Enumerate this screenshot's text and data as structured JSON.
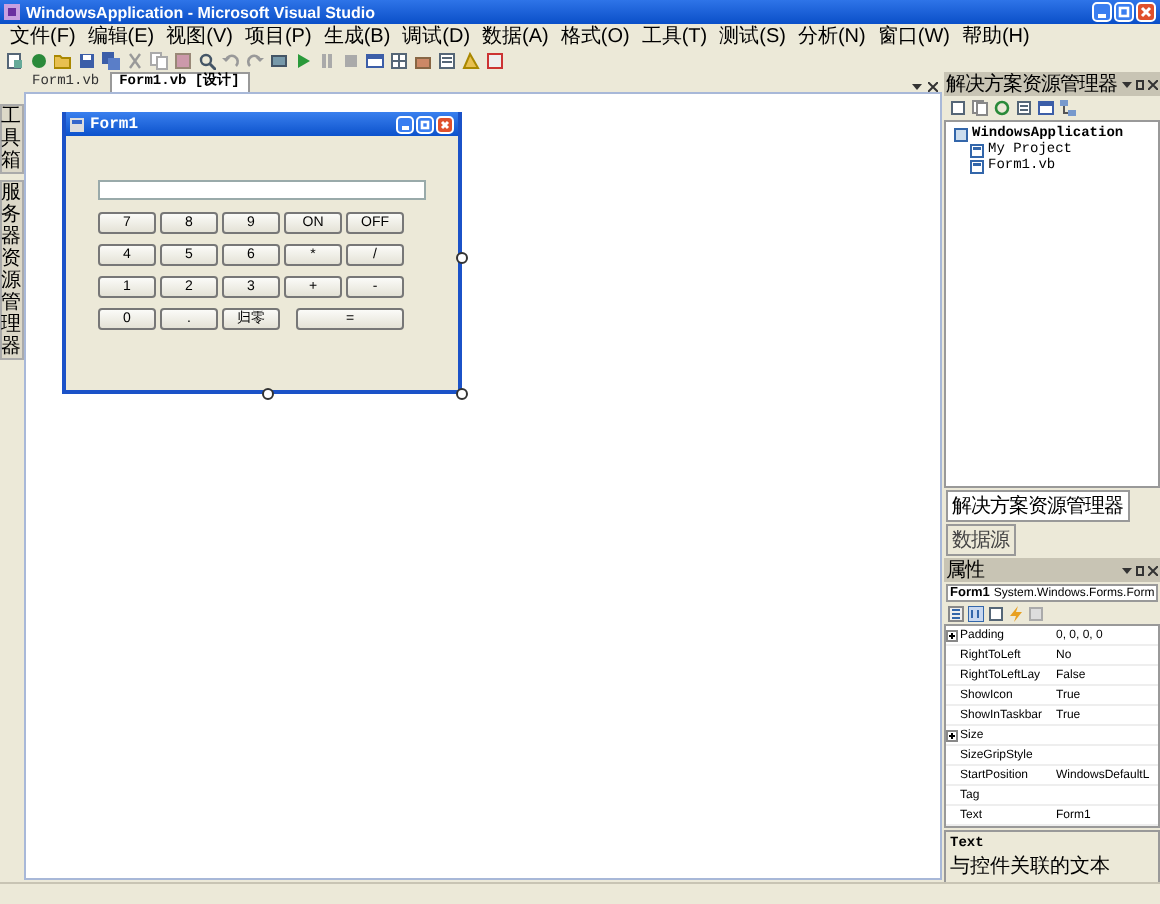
{
  "window": {
    "title": "WindowsApplication - Microsoft Visual Studio"
  },
  "menu": [
    "文件(F)",
    "编辑(E)",
    "视图(V)",
    "项目(P)",
    "生成(B)",
    "调试(D)",
    "数据(A)",
    "格式(O)",
    "工具(T)",
    "测试(S)",
    "分析(N)",
    "窗口(W)",
    "帮助(H)"
  ],
  "document_tabs": [
    {
      "label": "Form1.vb",
      "selected": false
    },
    {
      "label": "Form1.vb [设计]",
      "selected": true
    }
  ],
  "side_tabs": [
    "工具箱",
    "服务器资源管理器"
  ],
  "form": {
    "title": "Form1",
    "buttons": [
      {
        "label": "7",
        "kind": "normal"
      },
      {
        "label": "8",
        "kind": "normal"
      },
      {
        "label": "9",
        "kind": "normal"
      },
      {
        "label": "ON",
        "kind": "normal"
      },
      {
        "label": "OFF",
        "kind": "normal"
      },
      {
        "label": "4",
        "kind": "normal"
      },
      {
        "label": "5",
        "kind": "normal"
      },
      {
        "label": "6",
        "kind": "normal"
      },
      {
        "label": "*",
        "kind": "normal"
      },
      {
        "label": "/",
        "kind": "normal"
      },
      {
        "label": "1",
        "kind": "normal"
      },
      {
        "label": "2",
        "kind": "normal"
      },
      {
        "label": "3",
        "kind": "normal"
      },
      {
        "label": "+",
        "kind": "normal"
      },
      {
        "label": "-",
        "kind": "normal"
      },
      {
        "label": "0",
        "kind": "normal"
      },
      {
        "label": ".",
        "kind": "normal"
      },
      {
        "label": "归零",
        "kind": "normal"
      },
      {
        "label": "=",
        "kind": "wide"
      }
    ]
  },
  "solution_explorer": {
    "title": "解决方案资源管理器",
    "tree": [
      {
        "label": "WindowsApplication",
        "children": [
          {
            "label": "My Project"
          },
          {
            "label": "Form1.vb"
          }
        ]
      }
    ],
    "tabs": [
      {
        "label": "解决方案资源管理器",
        "selected": true
      },
      {
        "label": "数据源",
        "selected": false
      }
    ]
  },
  "properties": {
    "title": "属性",
    "object": "Form1",
    "object_type": "System.Windows.Forms.Form",
    "rows": [
      {
        "name": "Padding",
        "value": "0, 0, 0, 0",
        "expandable": true
      },
      {
        "name": "RightToLeft",
        "value": "No",
        "expandable": false
      },
      {
        "name": "RightToLeftLay",
        "value": "False",
        "expandable": false
      },
      {
        "name": "ShowIcon",
        "value": "True",
        "expandable": false
      },
      {
        "name": "ShowInTaskbar",
        "value": "True",
        "expandable": false
      },
      {
        "name": "Size",
        "expandable": true
      },
      {
        "name": "SizeGripStyle",
        "expandable": false
      },
      {
        "name": "StartPosition",
        "value": "WindowsDefaultL",
        "expandable": false
      },
      {
        "name": "Tag",
        "expandable": false
      },
      {
        "name": "Text",
        "value": "Form1",
        "expandable": false
      }
    ],
    "description_title": "Text",
    "description": "与控件关联的文本"
  }
}
